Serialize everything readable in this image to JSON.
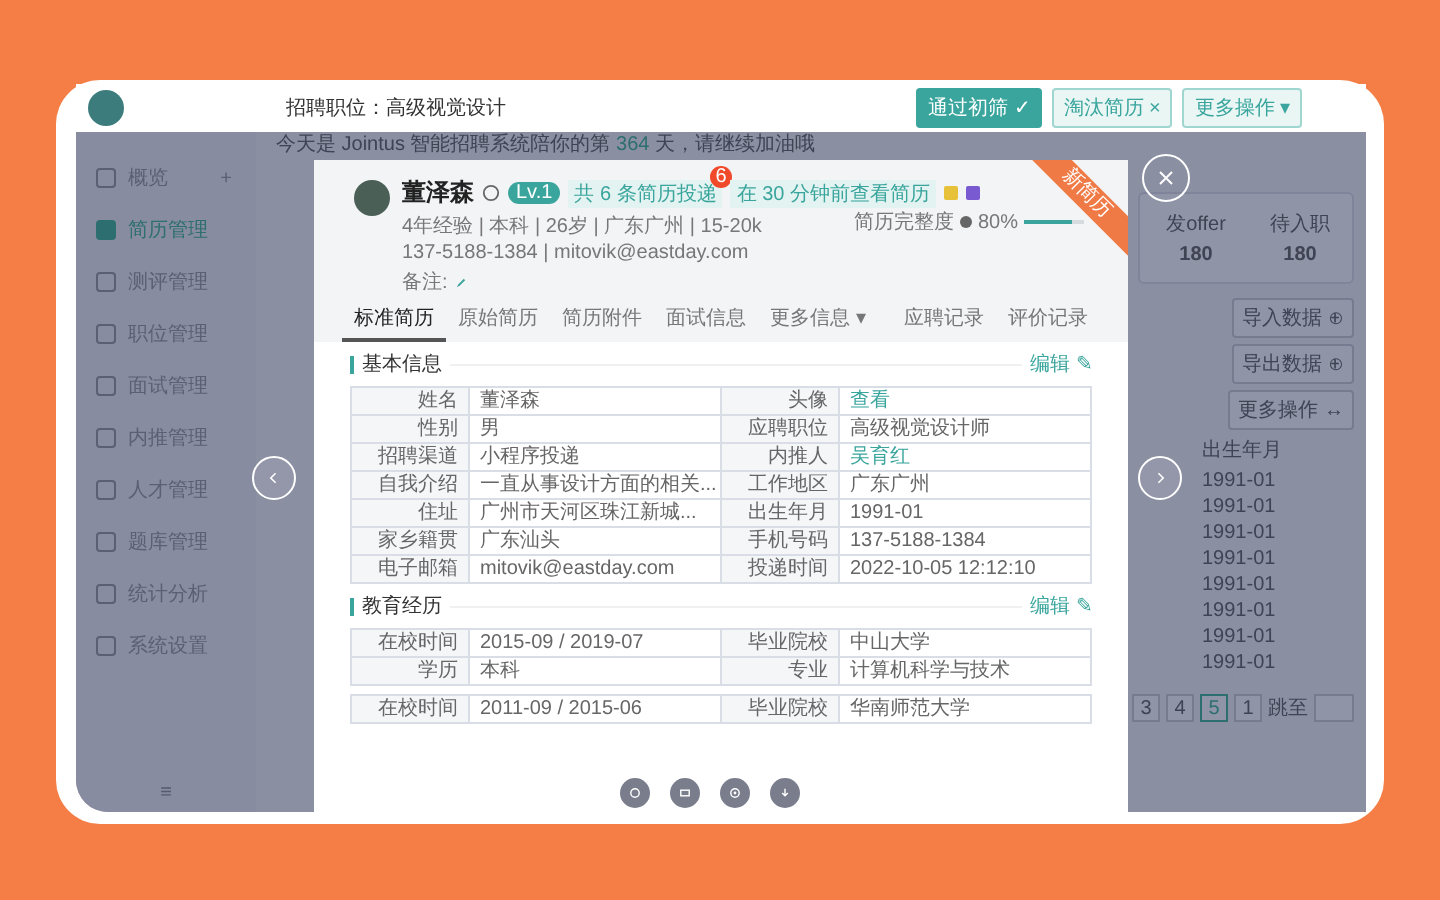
{
  "top_bar": {
    "job_label": "招聘职位：高级视觉设计",
    "buttons": [
      {
        "label": "通过初筛 ✓",
        "kind": "primary"
      },
      {
        "label": "淘汰简历 ×",
        "kind": "plain"
      },
      {
        "label": "更多操作 ▾",
        "kind": "plain"
      }
    ]
  },
  "sidebar": {
    "items": [
      {
        "label": "概览",
        "selected": false,
        "plus": "+"
      },
      {
        "label": "简历管理",
        "selected": true
      },
      {
        "label": "测评管理",
        "selected": false
      },
      {
        "label": "职位管理",
        "selected": false
      },
      {
        "label": "面试管理",
        "selected": false
      },
      {
        "label": "内推管理",
        "selected": false
      },
      {
        "label": "人才管理",
        "selected": false
      },
      {
        "label": "题库管理",
        "selected": false
      },
      {
        "label": "统计分析",
        "selected": false
      },
      {
        "label": "系统设置",
        "selected": false
      }
    ],
    "collapse": "≡"
  },
  "greeting": {
    "before": "今天是 Jointus 智能招聘系统陪你的第 ",
    "highlight": "364",
    "after": " 天，请继续加油哦"
  },
  "stats": [
    {
      "label": "发offer",
      "value": "180"
    },
    {
      "label": "待入职",
      "value": "180"
    }
  ],
  "actions": [
    "导入数据 ⊕",
    "导出数据 ⊕",
    "更多操作 ↔"
  ],
  "list": {
    "column": "出生年月",
    "rows": [
      "1991-01",
      "1991-01",
      "1991-01",
      "1991-01",
      "1991-01",
      "1991-01",
      "1991-01",
      "1991-01"
    ]
  },
  "pagination": {
    "pages": [
      {
        "label": "3",
        "selected": false
      },
      {
        "label": "4",
        "selected": false
      },
      {
        "label": "5",
        "selected": true
      },
      {
        "label": "1",
        "selected": false
      }
    ],
    "jump": "跳至"
  },
  "candidate": {
    "ribbon": "新简历",
    "name": "董泽森",
    "level": "Lv.1",
    "tags": [
      {
        "text": "共 6 条简历投递",
        "badge": "6"
      },
      {
        "text": "在 30 分钟前查看简历"
      }
    ],
    "info": "4年经验 | 本科 | 26岁 | 广东广州 | 15-20k",
    "contact": "137-5188-1384 | mitovik@eastday.com",
    "remark": "备注:",
    "completeness": {
      "label": "简历完整度",
      "reading": "80%",
      "level": 0.8
    }
  },
  "tabs": [
    {
      "label": "标准简历",
      "selected": true
    },
    {
      "label": "原始简历",
      "selected": false
    },
    {
      "label": "简历附件",
      "selected": false
    },
    {
      "label": "面试信息",
      "selected": false
    },
    {
      "label": "更多信息 ▾",
      "selected": false
    },
    {
      "label": "应聘记录",
      "selected": false
    },
    {
      "label": "评价记录",
      "selected": false
    }
  ],
  "sections": [
    {
      "title": "基本信息",
      "edit": "编辑 ✎",
      "tables": [
        [
          [
            {
              "label": "姓名",
              "value": "董泽森",
              "kind": "text"
            },
            {
              "label": "头像",
              "value": "查看",
              "kind": "link"
            }
          ],
          [
            {
              "label": "性别",
              "value": "男",
              "kind": "text"
            },
            {
              "label": "应聘职位",
              "value": "高级视觉设计师",
              "kind": "text"
            }
          ],
          [
            {
              "label": "招聘渠道",
              "value": "小程序投递",
              "kind": "text"
            },
            {
              "label": "内推人",
              "value": "吴育红",
              "kind": "link"
            }
          ],
          [
            {
              "label": "自我介绍",
              "value": "一直从事设计方面的相关...",
              "kind": "text"
            },
            {
              "label": "工作地区",
              "value": "广东广州",
              "kind": "text"
            }
          ],
          [
            {
              "label": "住址",
              "value": "广州市天河区珠江新城...",
              "kind": "text"
            },
            {
              "label": "出生年月",
              "value": "1991-01",
              "kind": "text"
            }
          ],
          [
            {
              "label": "家乡籍贯",
              "value": "广东汕头",
              "kind": "text"
            },
            {
              "label": "手机号码",
              "value": "137-5188-1384",
              "kind": "text"
            }
          ],
          [
            {
              "label": "电子邮箱",
              "value": "mitovik@eastday.com",
              "kind": "text"
            },
            {
              "label": "投递时间",
              "value": "2022-10-05 12:12:10",
              "kind": "text"
            }
          ]
        ]
      ]
    },
    {
      "title": "教育经历",
      "edit": "编辑 ✎",
      "tables": [
        [
          [
            {
              "label": "在校时间",
              "value": "2015-09 / 2019-07",
              "kind": "text"
            },
            {
              "label": "毕业院校",
              "value": "中山大学",
              "kind": "text"
            }
          ],
          [
            {
              "label": "学历",
              "value": "本科",
              "kind": "text"
            },
            {
              "label": "专业",
              "value": "计算机科学与技术",
              "kind": "text"
            }
          ]
        ],
        [
          [
            {
              "label": "在校时间",
              "value": "2011-09 / 2015-06",
              "kind": "text"
            },
            {
              "label": "毕业院校",
              "value": "华南师范大学",
              "kind": "text"
            }
          ]
        ]
      ]
    }
  ]
}
